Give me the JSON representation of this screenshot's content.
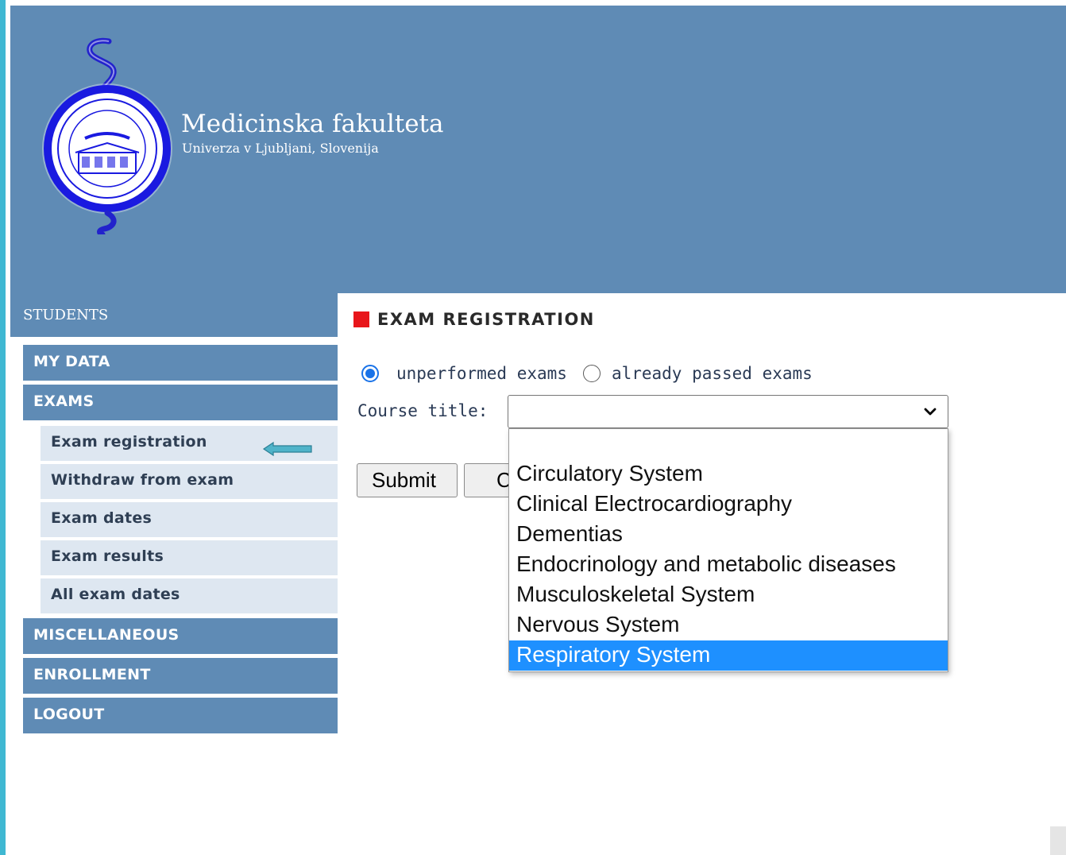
{
  "header": {
    "title": "Medicinska fakulteta",
    "subtitle": "Univerza v Ljubljani, Slovenija"
  },
  "sidebar": {
    "section_label": "STUDENTS",
    "items": [
      {
        "label": "MY DATA"
      },
      {
        "label": "EXAMS"
      },
      {
        "label": "MISCELLANEOUS"
      },
      {
        "label": "ENROLLMENT"
      },
      {
        "label": "LOGOUT"
      }
    ],
    "exam_subitems": [
      {
        "label": "Exam registration",
        "active": true
      },
      {
        "label": "Withdraw from exam"
      },
      {
        "label": "Exam dates"
      },
      {
        "label": "Exam results"
      },
      {
        "label": "All exam dates"
      }
    ]
  },
  "main": {
    "title": "EXAM REGISTRATION",
    "radio_options": [
      {
        "label": "unperformed exams",
        "checked": true
      },
      {
        "label": "already passed exams",
        "checked": false
      }
    ],
    "course_label": "Course title:",
    "course_value": "",
    "submit_label": "Submit",
    "clear_label_visible": "C",
    "dropdown_options": [
      "",
      "Circulatory System",
      "Clinical Electrocardiography",
      "Dementias",
      "Endocrinology and metabolic diseases",
      "Musculoskeletal System",
      "Nervous System",
      "Respiratory System"
    ],
    "highlighted_option": "Respiratory System"
  },
  "colors": {
    "header_bg": "#5f8bb5",
    "submenu_bg": "#dee7f1",
    "accent_red": "#e8161b",
    "highlight": "#1e90ff",
    "left_stripe": "#3fb8d2"
  },
  "icons": [
    "logo-emblem",
    "arrow-left-icon",
    "chevron-down-icon",
    "radio-checked",
    "radio-unchecked"
  ]
}
